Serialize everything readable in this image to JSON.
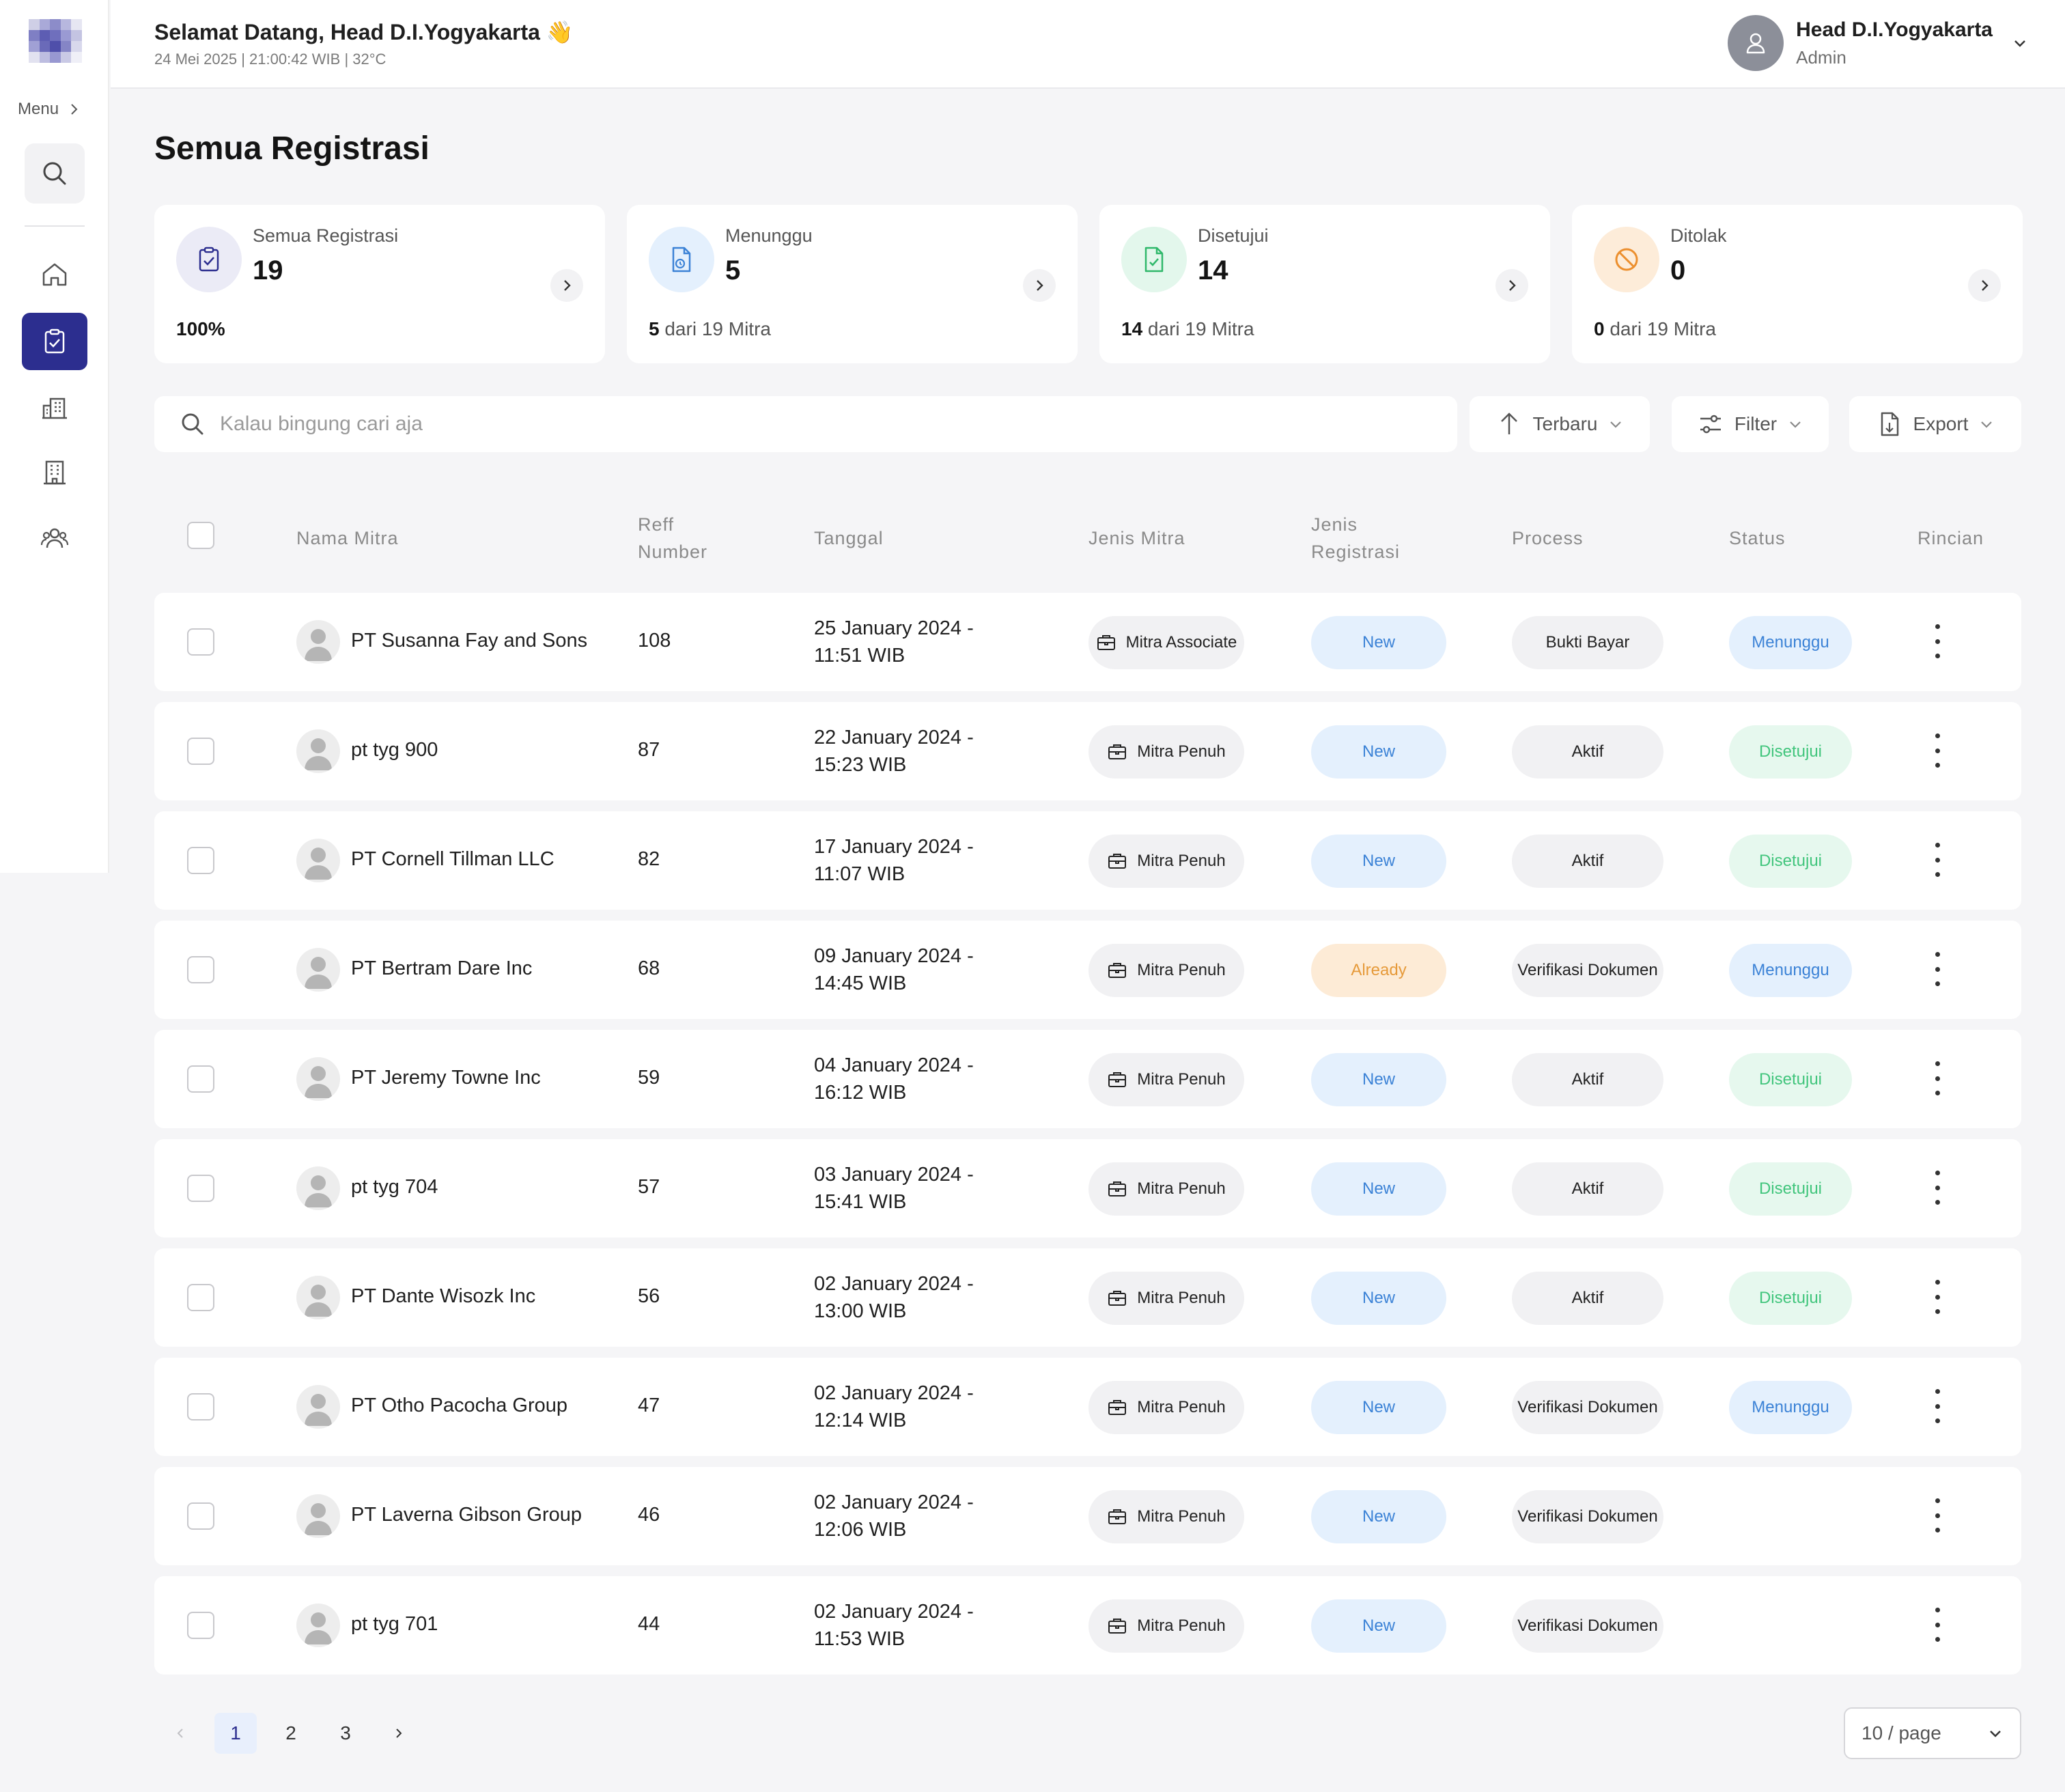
{
  "sidebar": {
    "menu_label": "Menu",
    "logo_colors": [
      "#cfcfe6",
      "#a9a9d8",
      "#8c8cc9",
      "#b7b7de",
      "#e6e6f2",
      "#7f7fc4",
      "#5d5db3",
      "#6f6fbd",
      "#9a9ad3",
      "#c4c4e2",
      "#a0a0d5",
      "#6a6ab9",
      "#4f4faa",
      "#8585c6",
      "#d8d8ec",
      "#e2e2f0",
      "#bdbde0",
      "#9898d1",
      "#c9c9e5",
      "#efeff7"
    ],
    "items": [
      {
        "name": "search",
        "icon": "search-icon"
      },
      {
        "name": "home",
        "icon": "home-icon"
      },
      {
        "name": "registrasi",
        "icon": "clipboard-check-icon",
        "active": true
      },
      {
        "name": "buildings",
        "icon": "buildings-icon"
      },
      {
        "name": "office",
        "icon": "office-building-icon"
      },
      {
        "name": "users",
        "icon": "users-icon"
      }
    ],
    "active_color": "#2c2e8f"
  },
  "header": {
    "greeting": "Selamat Datang, Head D.I.Yogyakarta 👋",
    "subinfo": "24 Mei 2025 | 21:00:42 WIB | 32°C",
    "user_name": "Head D.I.Yogyakarta",
    "user_role": "Admin"
  },
  "page_title": "Semua Registrasi",
  "stats": [
    {
      "label": "Semua Registrasi",
      "value": "19",
      "foot_bold": "100%",
      "foot_rest": "",
      "icon": "clipboard-check-icon",
      "icon_bg": "#ebebf6",
      "icon_color": "#2c2e8f"
    },
    {
      "label": "Menunggu",
      "value": "5",
      "foot_bold": "5",
      "foot_rest": " dari 19 Mitra",
      "icon": "document-clock-icon",
      "icon_bg": "#e4f0fd",
      "icon_color": "#3b82d6"
    },
    {
      "label": "Disetujui",
      "value": "14",
      "foot_bold": "14",
      "foot_rest": " dari 19 Mitra",
      "icon": "document-check-icon",
      "icon_bg": "#e3f7ec",
      "icon_color": "#2fb86a"
    },
    {
      "label": "Ditolak",
      "value": "0",
      "foot_bold": "0",
      "foot_rest": " dari 19 Mitra",
      "icon": "ban-icon",
      "icon_bg": "#fdecd9",
      "icon_color": "#ec8f2e"
    }
  ],
  "toolbar": {
    "search_placeholder": "Kalau bingung cari aja",
    "sort_label": "Terbaru",
    "filter_label": "Filter",
    "export_label": "Export"
  },
  "table": {
    "headers": {
      "nama": "Nama Mitra",
      "ref_1": "Reff",
      "ref_2": "Number",
      "tanggal": "Tanggal",
      "jenis_mitra": "Jenis Mitra",
      "jenis_reg_1": "Jenis",
      "jenis_reg_2": "Registrasi",
      "process": "Process",
      "status": "Status",
      "rincian": "Rincian"
    },
    "rows": [
      {
        "name": "PT Susanna Fay and Sons",
        "ref": "108",
        "date_1": "25 January 2024 -",
        "date_2": "11:51 WIB",
        "jenis": "Mitra Associate",
        "reg": "New",
        "reg_type": "new",
        "process": "Bukti Bayar",
        "status": "Menunggu",
        "status_type": "menunggu"
      },
      {
        "name": "pt tyg 900",
        "ref": "87",
        "date_1": "22 January 2024 -",
        "date_2": "15:23 WIB",
        "jenis": "Mitra Penuh",
        "reg": "New",
        "reg_type": "new",
        "process": "Aktif",
        "status": "Disetujui",
        "status_type": "disetujui"
      },
      {
        "name": "PT Cornell Tillman LLC",
        "ref": "82",
        "date_1": "17 January 2024 -",
        "date_2": "11:07 WIB",
        "jenis": "Mitra Penuh",
        "reg": "New",
        "reg_type": "new",
        "process": "Aktif",
        "status": "Disetujui",
        "status_type": "disetujui"
      },
      {
        "name": "PT Bertram Dare Inc",
        "ref": "68",
        "date_1": "09 January 2024 -",
        "date_2": "14:45 WIB",
        "jenis": "Mitra Penuh",
        "reg": "Already",
        "reg_type": "already",
        "process": "Verifikasi Dokumen",
        "status": "Menunggu",
        "status_type": "menunggu"
      },
      {
        "name": "PT Jeremy Towne Inc",
        "ref": "59",
        "date_1": "04 January 2024 -",
        "date_2": "16:12 WIB",
        "jenis": "Mitra Penuh",
        "reg": "New",
        "reg_type": "new",
        "process": "Aktif",
        "status": "Disetujui",
        "status_type": "disetujui"
      },
      {
        "name": "pt tyg 704",
        "ref": "57",
        "date_1": "03 January 2024 -",
        "date_2": "15:41 WIB",
        "jenis": "Mitra Penuh",
        "reg": "New",
        "reg_type": "new",
        "process": "Aktif",
        "status": "Disetujui",
        "status_type": "disetujui"
      },
      {
        "name": "PT Dante Wisozk Inc",
        "ref": "56",
        "date_1": "02 January 2024 -",
        "date_2": "13:00 WIB",
        "jenis": "Mitra Penuh",
        "reg": "New",
        "reg_type": "new",
        "process": "Aktif",
        "status": "Disetujui",
        "status_type": "disetujui"
      },
      {
        "name": "PT Otho Pacocha Group",
        "ref": "47",
        "date_1": "02 January 2024 -",
        "date_2": "12:14 WIB",
        "jenis": "Mitra Penuh",
        "reg": "New",
        "reg_type": "new",
        "process": "Verifikasi Dokumen",
        "status": "Menunggu",
        "status_type": "menunggu"
      },
      {
        "name": "PT Laverna Gibson Group",
        "ref": "46",
        "date_1": "02 January 2024 -",
        "date_2": "12:06 WIB",
        "jenis": "Mitra Penuh",
        "reg": "New",
        "reg_type": "new",
        "process": "Verifikasi Dokumen",
        "status": "",
        "status_type": ""
      },
      {
        "name": "pt tyg 701",
        "ref": "44",
        "date_1": "02 January 2024 -",
        "date_2": "11:53 WIB",
        "jenis": "Mitra Penuh",
        "reg": "New",
        "reg_type": "new",
        "process": "Verifikasi Dokumen",
        "status": "",
        "status_type": ""
      }
    ]
  },
  "pagination": {
    "pages": [
      "1",
      "2",
      "3"
    ],
    "current": "1",
    "page_size": "10 / page"
  }
}
